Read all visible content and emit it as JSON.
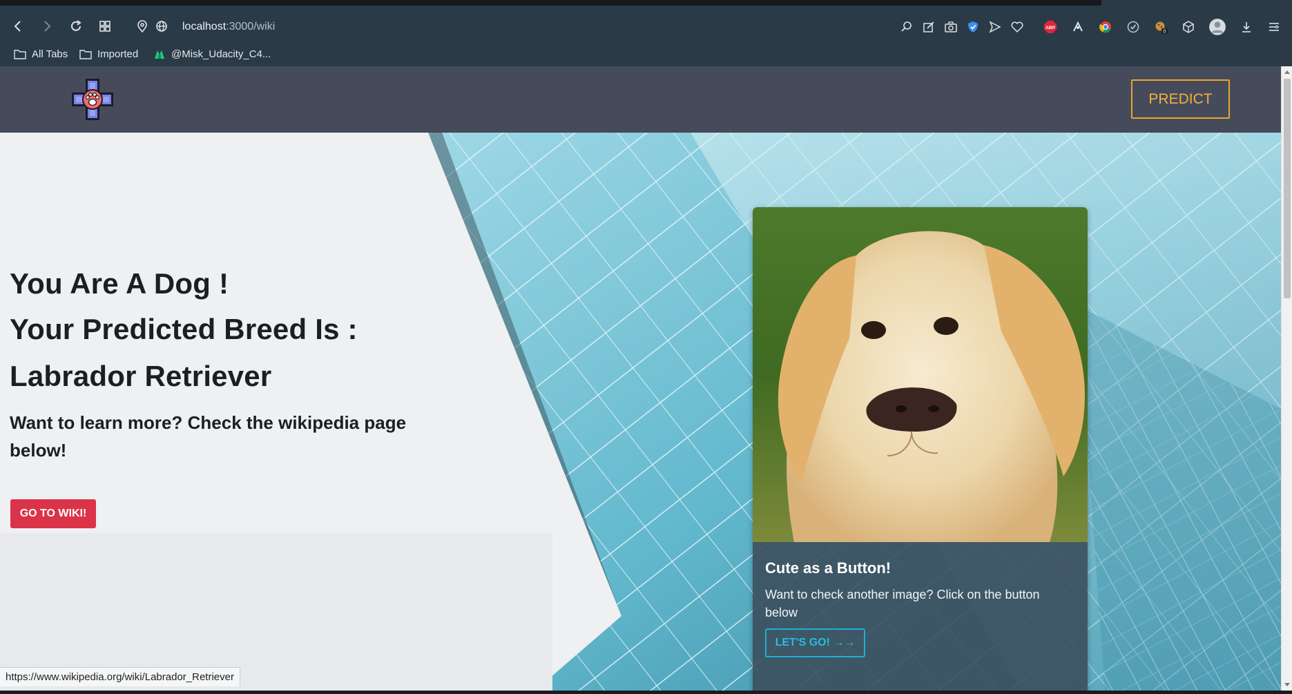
{
  "browser": {
    "url_host": "localhost",
    "url_path": ":3000/wiki",
    "bookmarks": [
      {
        "label": "All Tabs",
        "icon": "folder-icon"
      },
      {
        "label": "Imported",
        "icon": "folder-icon"
      },
      {
        "label": "@Misk_Udacity_C4...",
        "icon": "bookmark-site-icon"
      }
    ],
    "extension_badge": "0",
    "abp_label": "ABP"
  },
  "app": {
    "nav": {
      "predict_label": "PREDICT"
    },
    "hero": {
      "line1": "You Are A Dog !",
      "line2": "Your Predicted Breed Is :",
      "breed": "Labrador Retriever",
      "subtitle": "Want to learn more? Check the wikipedia page below!",
      "wiki_button": "GO TO WIKI!"
    },
    "card": {
      "title": "Cute as a Button!",
      "text": "Want to check another image? Click on the button below",
      "button": "LET'S GO! →→"
    }
  },
  "status_url": "https://www.wikipedia.org/wiki/Labrador_Retriever",
  "colors": {
    "accent_predict": "#f0b23a",
    "wiki_button": "#db3348",
    "letsgo": "#27bde0",
    "header": "#464b5c"
  }
}
